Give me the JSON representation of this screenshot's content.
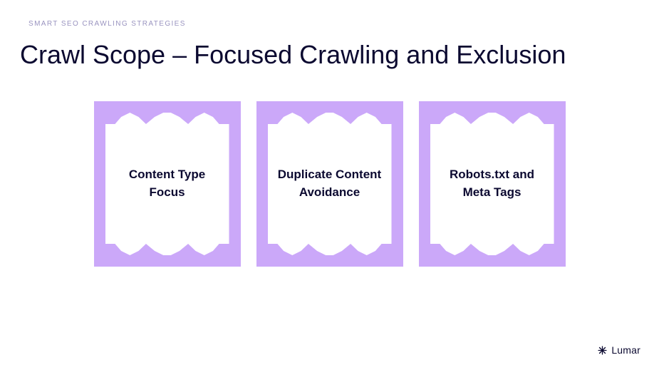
{
  "eyebrow": "SMART SEO CRAWLING STRATEGIES",
  "title": "Crawl Scope – Focused Crawling and Exclusion",
  "cards": [
    {
      "label": "Content Type Focus"
    },
    {
      "label": "Duplicate Content Avoidance"
    },
    {
      "label": "Robots.txt and Meta Tags"
    }
  ],
  "brand": {
    "name": "Lumar"
  },
  "colors": {
    "accent_lavender": "#cba8f9",
    "text_dark": "#0b0930",
    "eyebrow": "#9a94c0",
    "white": "#ffffff"
  }
}
